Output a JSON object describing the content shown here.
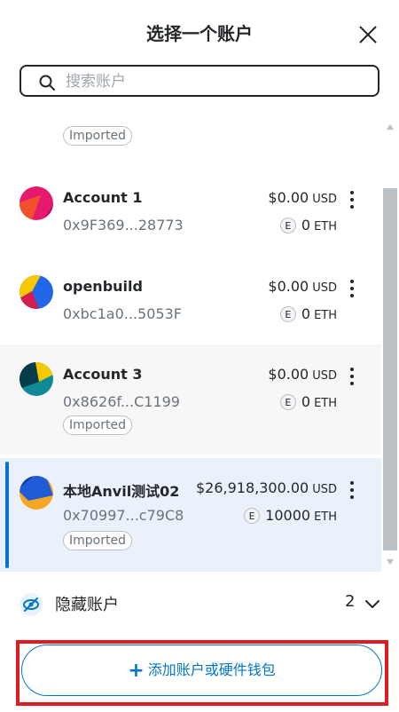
{
  "header": {
    "title": "选择一个账户"
  },
  "search": {
    "placeholder": "搜索账户"
  },
  "partial_item": {
    "badge": "Imported"
  },
  "accounts": [
    {
      "name": "Account 1",
      "address": "0x9F369...28773",
      "fiat": "$0.00",
      "fiat_unit": "USD",
      "token": "0",
      "token_unit": "ETH",
      "badge": null,
      "selected": false
    },
    {
      "name": "openbuild",
      "address": "0xbc1a0...5053F",
      "fiat": "$0.00",
      "fiat_unit": "USD",
      "token": "0",
      "token_unit": "ETH",
      "badge": null,
      "selected": false
    },
    {
      "name": "Account 3",
      "address": "0x8626f...C1199",
      "fiat": "$0.00",
      "fiat_unit": "USD",
      "token": "0",
      "token_unit": "ETH",
      "badge": "Imported",
      "selected": false
    },
    {
      "name": "本地Anvil测试02",
      "address": "0x70997...c79C8",
      "fiat": "$26,918,300.00",
      "fiat_unit": "USD",
      "token": "10000",
      "token_unit": "ETH",
      "badge": "Imported",
      "selected": true
    }
  ],
  "token_icon_letter": "E",
  "hidden_accounts": {
    "label": "隐藏账户",
    "count": "2"
  },
  "add_button": {
    "label": "添加账户或硬件钱包"
  },
  "colors": {
    "accent": "#0376c9",
    "highlight": "#e01b24",
    "selected_bg": "#eaf1fa"
  }
}
